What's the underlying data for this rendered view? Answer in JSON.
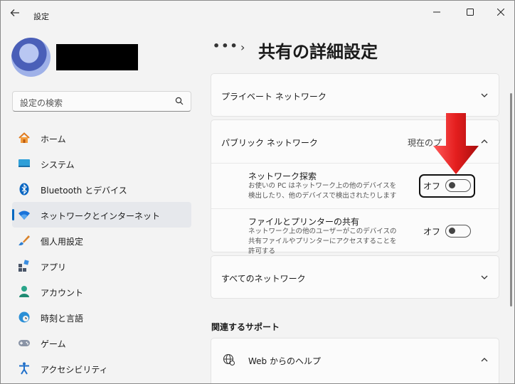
{
  "window": {
    "title": "設定",
    "back_icon": "arrow-left-icon"
  },
  "search": {
    "placeholder": "設定の検索"
  },
  "nav": {
    "items": [
      {
        "label": "ホーム",
        "icon": "home-icon"
      },
      {
        "label": "システム",
        "icon": "system-icon"
      },
      {
        "label": "Bluetooth とデバイス",
        "icon": "bluetooth-icon"
      },
      {
        "label": "ネットワークとインターネット",
        "icon": "wifi-icon",
        "selected": true
      },
      {
        "label": "個人用設定",
        "icon": "brush-icon"
      },
      {
        "label": "アプリ",
        "icon": "apps-icon"
      },
      {
        "label": "アカウント",
        "icon": "account-icon"
      },
      {
        "label": "時刻と言語",
        "icon": "time-language-icon"
      },
      {
        "label": "ゲーム",
        "icon": "gamepad-icon"
      },
      {
        "label": "アクセシビリティ",
        "icon": "accessibility-icon"
      }
    ]
  },
  "breadcrumb": {
    "ellipsis": "•••",
    "separator": "›"
  },
  "page": {
    "title": "共有の詳細設定"
  },
  "private_network": {
    "title": "プライベート ネットワーク"
  },
  "public_network": {
    "title": "パブリック ネットワーク",
    "status": "現在のプ",
    "settings": [
      {
        "title": "ネットワーク探索",
        "description": "お使いの PC はネットワーク上の他のデバイスを検出したり、他のデバイスで検出されたりします",
        "state": "オフ",
        "on": false
      },
      {
        "title": "ファイルとプリンターの共有",
        "description": "ネットワーク上の他のユーザーがこのデバイスの共有ファイルやプリンターにアクセスすることを許可する",
        "state": "オフ",
        "on": false
      }
    ]
  },
  "all_networks": {
    "title": "すべてのネットワーク"
  },
  "related": {
    "heading": "関連するサポート",
    "help_title": "Web からのヘルプ"
  },
  "colors": {
    "accent": "#0067c0",
    "arrow_red": "#e41e1e"
  }
}
